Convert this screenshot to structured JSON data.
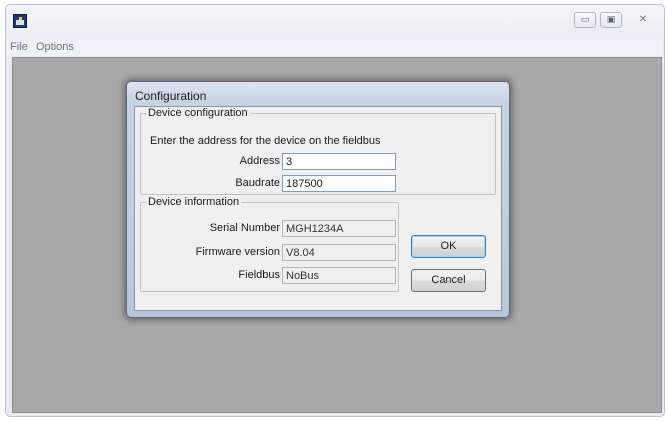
{
  "window": {
    "minimize_glyph": "▭",
    "maximize_glyph": "▣",
    "close_glyph": "✕"
  },
  "menubar": {
    "items": [
      {
        "label": "File"
      },
      {
        "label": "Options"
      }
    ]
  },
  "dialog": {
    "title": "Configuration",
    "device_configuration": {
      "legend": "Device configuration",
      "instruction": "Enter the address for the device on the fieldbus",
      "address_label": "Address",
      "address_value": "3",
      "baudrate_label": "Baudrate",
      "baudrate_value": "187500"
    },
    "device_information": {
      "legend": "Device information",
      "serial_number_label": "Serial Number",
      "serial_number_value": "MGH1234A",
      "firmware_version_label": "Firmware version",
      "firmware_version_value": "V8.04",
      "fieldbus_label": "Fieldbus",
      "fieldbus_value": "NoBus"
    },
    "ok_label": "OK",
    "cancel_label": "Cancel"
  },
  "icons": {
    "app": "app-icon",
    "minimize": "minimize-icon",
    "maximize": "maximize-icon",
    "close": "close-icon"
  }
}
